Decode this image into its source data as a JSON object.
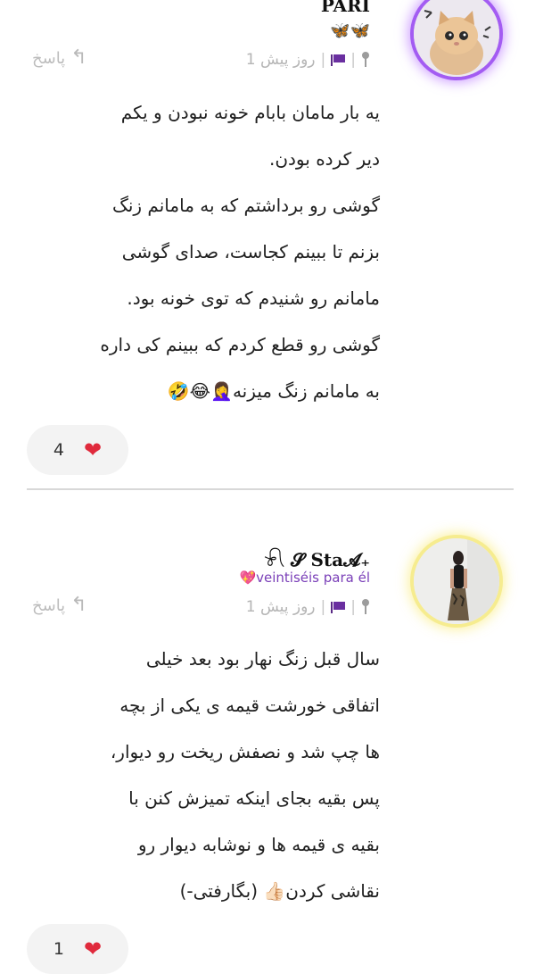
{
  "comments": [
    {
      "author": "PARI",
      "author_decoration": "🦋🦋",
      "time": "1 روز پیش",
      "separator": "|",
      "reply_label": "پاسخ",
      "lines": [
        "یه بار مامان بابام خونه نبودن و یکم",
        "دیر کرده بودن.",
        "گوشی رو برداشتم که به مامانم زنگ",
        "بزنم تا ببینم کجاست، صدای گوشی",
        "مامانم رو شنیدم که توی خونه بود.",
        "گوشی رو قطع کردم که ببینم کی داره",
        "به مامانم زنگ میزنه🤦‍♀️😂🤣"
      ],
      "likes": "4",
      "avatar_icon": "kitten-avatar"
    },
    {
      "author": "𓍯 𝓢 𝐒𝐭𝐚𝓐₊",
      "tagline": "💖veintiséis para él",
      "time": "1 روز پیش",
      "separator": "|",
      "reply_label": "پاسخ",
      "lines": [
        "سال قبل زنگ نهار بود بعد خیلی",
        "اتفاقی خورشت قیمه ی یکی از بچه",
        "ها چپ شد و نصفش ریخت رو دیوار،",
        "پس بقیه بجای اینکه تمیزش کنن با",
        "بقیه ی قیمه ها و نوشابه دیوار رو",
        "نقاشی کردن👍🏻 (بگارفتی-)"
      ],
      "likes": "1",
      "avatar_icon": "person-avatar"
    }
  ],
  "colors": {
    "heart": "#e02a3c",
    "flag": "#6a2fa0",
    "avatar1_ring": "#a35cf2",
    "avatar2_ring": "#f6ec8f",
    "tagline": "#7a3fb8"
  }
}
